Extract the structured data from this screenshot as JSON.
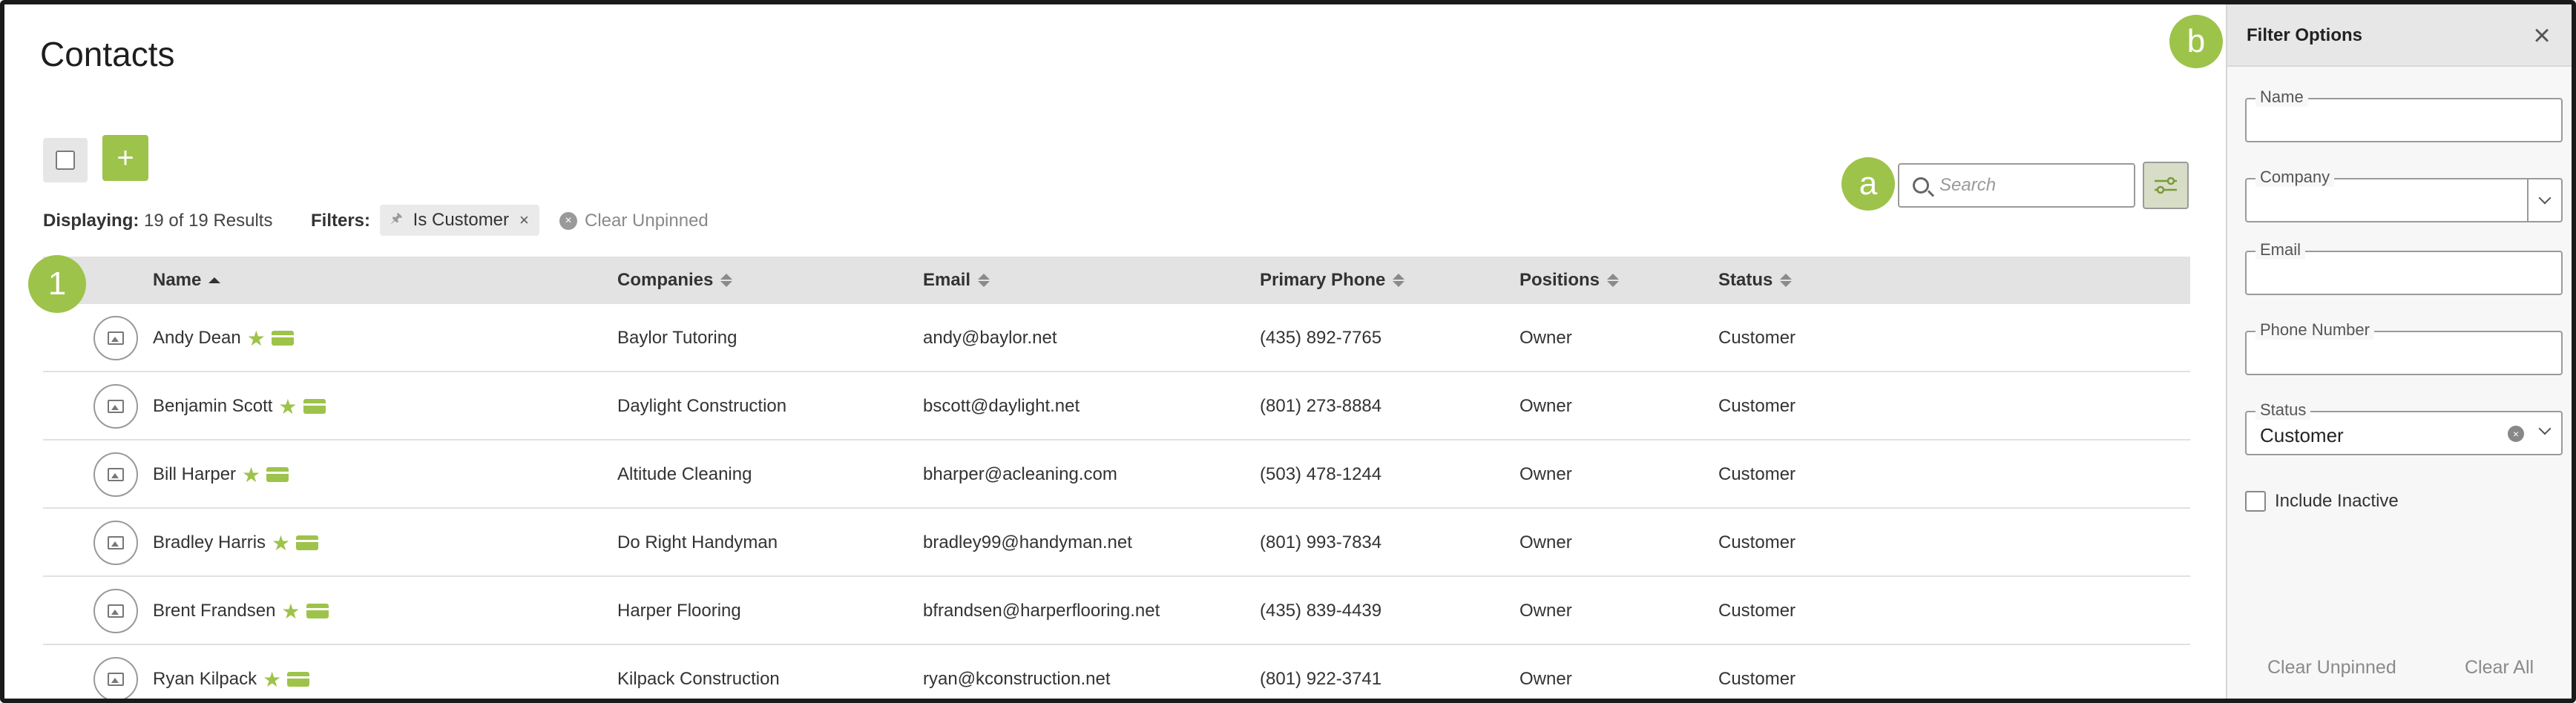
{
  "page": {
    "title": "Contacts",
    "displaying_label": "Displaying:",
    "displaying_value": "19 of 19 Results",
    "filters_label": "Filters:",
    "filter_chip": "Is Customer",
    "clear_unpinned": "Clear Unpinned",
    "add_label": "+",
    "search_placeholder": "Search"
  },
  "badges": {
    "a": "a",
    "one": "1",
    "b": "b"
  },
  "table": {
    "columns": [
      {
        "key": "name",
        "label": "Name"
      },
      {
        "key": "company",
        "label": "Companies"
      },
      {
        "key": "email",
        "label": "Email"
      },
      {
        "key": "phone",
        "label": "Primary Phone"
      },
      {
        "key": "position",
        "label": "Positions"
      },
      {
        "key": "status",
        "label": "Status"
      }
    ],
    "rows": [
      {
        "name": "Andy Dean",
        "company": "Baylor Tutoring",
        "email": "andy@baylor.net",
        "phone": "(435) 892-7765",
        "position": "Owner",
        "status": "Customer"
      },
      {
        "name": "Benjamin Scott",
        "company": "Daylight Construction",
        "email": "bscott@daylight.net",
        "phone": "(801) 273-8884",
        "position": "Owner",
        "status": "Customer"
      },
      {
        "name": "Bill Harper",
        "company": "Altitude Cleaning",
        "email": "bharper@acleaning.com",
        "phone": "(503) 478-1244",
        "position": "Owner",
        "status": "Customer"
      },
      {
        "name": "Bradley Harris",
        "company": "Do Right Handyman",
        "email": "bradley99@handyman.net",
        "phone": "(801) 993-7834",
        "position": "Owner",
        "status": "Customer"
      },
      {
        "name": "Brent Frandsen",
        "company": "Harper Flooring",
        "email": "bfrandsen@harperflooring.net",
        "phone": "(435) 839-4439",
        "position": "Owner",
        "status": "Customer"
      },
      {
        "name": "Ryan Kilpack",
        "company": "Kilpack Construction",
        "email": "ryan@kconstruction.net",
        "phone": "(801) 922-3741",
        "position": "Owner",
        "status": "Customer"
      }
    ]
  },
  "panel": {
    "title": "Filter Options",
    "close": "×",
    "fields": {
      "name": {
        "label": "Name",
        "value": ""
      },
      "company": {
        "label": "Company",
        "value": ""
      },
      "email": {
        "label": "Email",
        "value": ""
      },
      "phone": {
        "label": "Phone Number",
        "value": ""
      },
      "status": {
        "label": "Status",
        "value": "Customer"
      }
    },
    "include_inactive": "Include Inactive",
    "clear_unpinned": "Clear Unpinned",
    "clear_all": "Clear All"
  },
  "colors": {
    "accent": "#9dc34a",
    "header_bg": "#e3e3e3",
    "panel_bg": "#f7f7f7"
  }
}
